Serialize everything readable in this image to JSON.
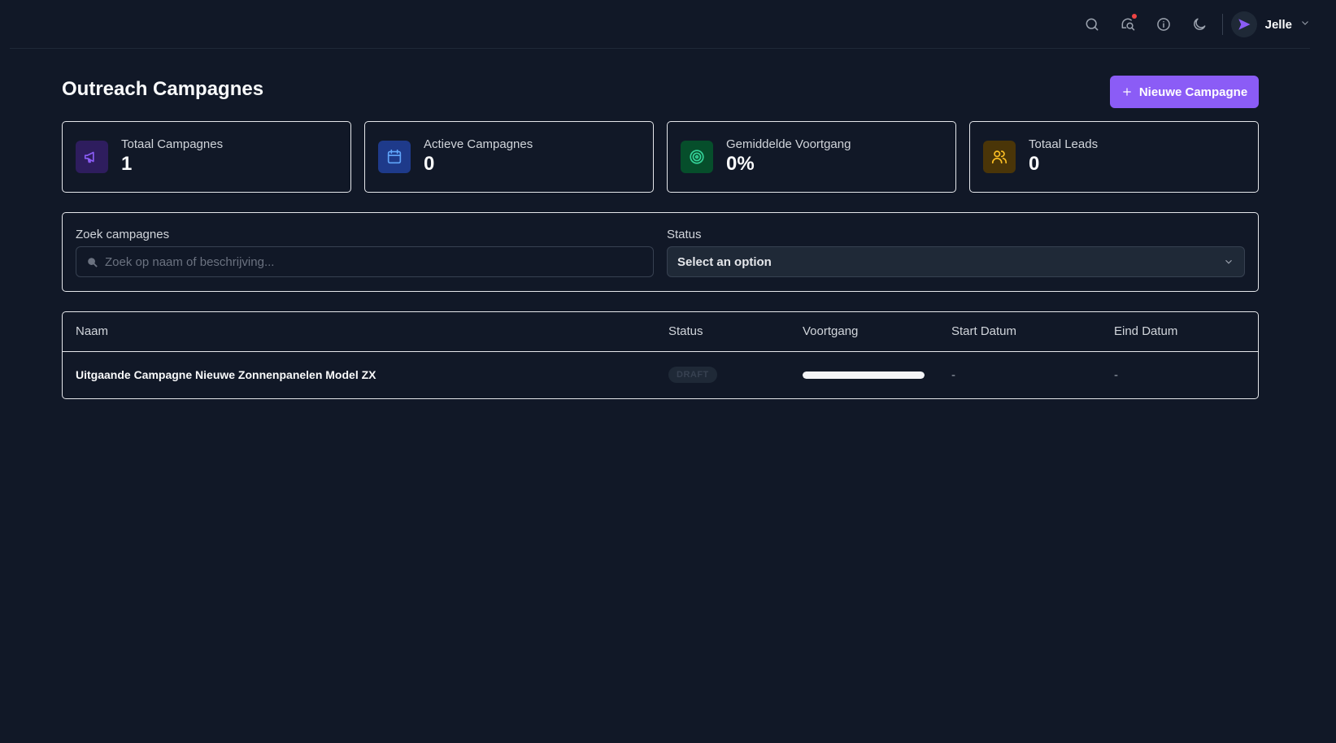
{
  "topbar": {
    "icons": [
      "search-icon",
      "notifications-icon",
      "info-icon",
      "moon-icon"
    ],
    "notification_dot_color": "#ef4444",
    "user": {
      "name": "Jelle"
    }
  },
  "header": {
    "title": "Outreach Campagnes",
    "new_button_label": "Nieuwe Campagne",
    "accent_color": "#8b5cf6"
  },
  "stats": [
    {
      "label": "Totaal Campagnes",
      "value": "1",
      "icon": "megaphone-icon",
      "color": "#8b5cf6",
      "bg": "#2e1d5e"
    },
    {
      "label": "Actieve Campagnes",
      "value": "0",
      "icon": "calendar-icon",
      "color": "#60a5fa",
      "bg": "#1e3a8a"
    },
    {
      "label": "Gemiddelde Voortgang",
      "value": "0%",
      "icon": "target-icon",
      "color": "#34d399",
      "bg": "#064e2b"
    },
    {
      "label": "Totaal Leads",
      "value": "0",
      "icon": "users-icon",
      "color": "#fbbf24",
      "bg": "#4a3508"
    }
  ],
  "filters": {
    "search_label": "Zoek campagnes",
    "search_placeholder": "Zoek op naam of beschrijving...",
    "search_value": "",
    "status_label": "Status",
    "status_selected": "Select an option"
  },
  "table": {
    "columns": [
      "Naam",
      "Status",
      "Voortgang",
      "Start Datum",
      "Eind Datum"
    ],
    "rows": [
      {
        "name": "Uitgaande Campagne Nieuwe Zonnenpanelen Model ZX",
        "status": "DRAFT",
        "progress": 1.0,
        "start": "-",
        "end": "-"
      }
    ]
  }
}
